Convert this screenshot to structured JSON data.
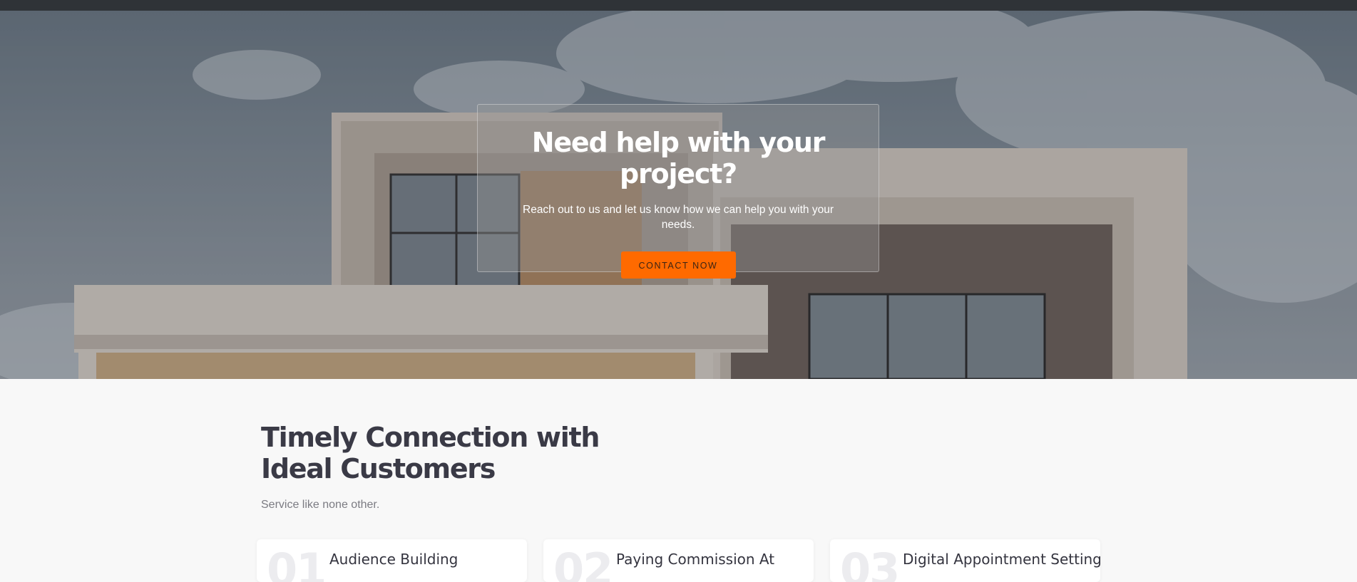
{
  "hero": {
    "title": "Need help with your project?",
    "subtitle": "Reach out to us and let us know how we can help you with your needs.",
    "button_label": "CONTACT NOW"
  },
  "section": {
    "title": "Timely Connection with Ideal Customers",
    "subtitle": "Service like none other."
  },
  "cards": [
    {
      "number": "01",
      "title": "Audience Building"
    },
    {
      "number": "02",
      "title": "Paying Commission At"
    },
    {
      "number": "03",
      "title": "Digital Appointment Setting"
    }
  ],
  "colors": {
    "accent": "#ff6a00",
    "heading": "#3a3a46",
    "topbar": "#2f3337"
  }
}
